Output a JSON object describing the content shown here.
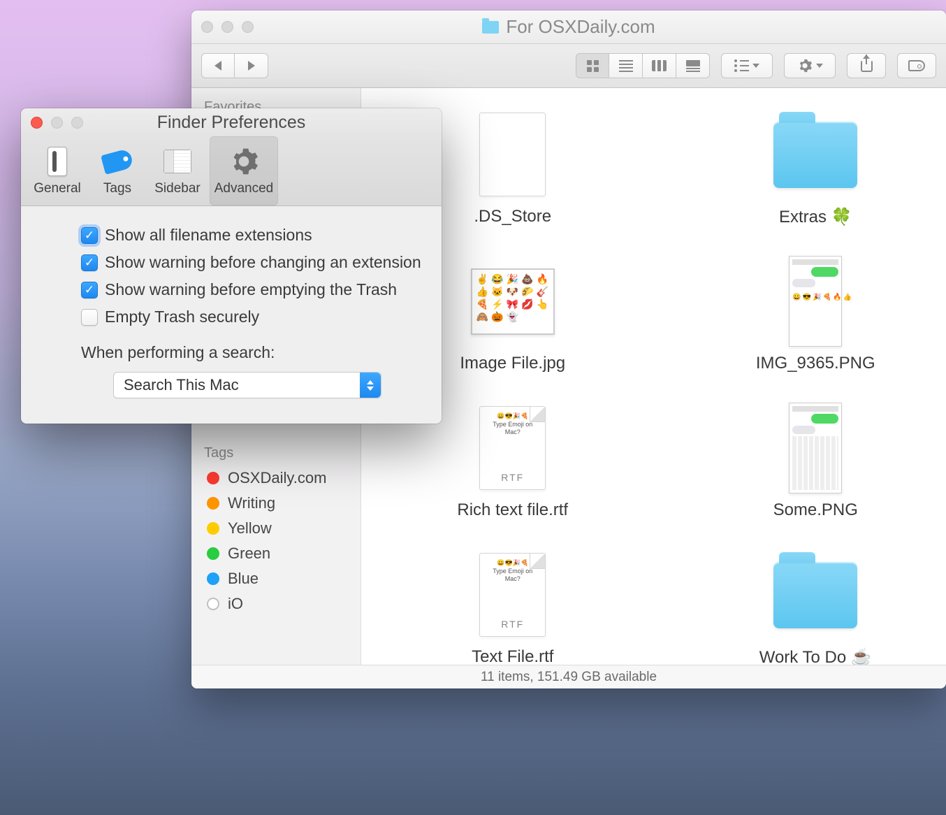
{
  "finder": {
    "title": "For OSXDaily.com",
    "sidebar": {
      "favorites_header": "Favorites",
      "tags_header": "Tags",
      "tags": [
        {
          "label": "OSXDaily.com",
          "color": "#fc3b30"
        },
        {
          "label": "Writing",
          "color": "#ff9500"
        },
        {
          "label": "Yellow",
          "color": "#ffcc00"
        },
        {
          "label": "Green",
          "color": "#28cd41"
        },
        {
          "label": "Blue",
          "color": "#1da1f9"
        },
        {
          "label": "iO",
          "color": "#ffffff"
        }
      ]
    },
    "files": [
      {
        "name": ".DS_Store",
        "kind": "blank"
      },
      {
        "name": "Extras 🍀",
        "kind": "folder"
      },
      {
        "name": "Image File.jpg",
        "kind": "image"
      },
      {
        "name": "IMG_9365.PNG",
        "kind": "phone"
      },
      {
        "name": "Rich text file.rtf",
        "kind": "rtf"
      },
      {
        "name": "Some.PNG",
        "kind": "phone-kb"
      },
      {
        "name": "Text File.rtf",
        "kind": "rtf"
      },
      {
        "name": "Work To Do ☕",
        "kind": "folder"
      }
    ],
    "status": "11 items, 151.49 GB available"
  },
  "prefs": {
    "title": "Finder Preferences",
    "tabs": {
      "general": "General",
      "tags": "Tags",
      "sidebar": "Sidebar",
      "advanced": "Advanced"
    },
    "options": {
      "show_ext": "Show all filename extensions",
      "warn_ext": "Show warning before changing an extension",
      "warn_trash": "Show warning before emptying the Trash",
      "secure_trash": "Empty Trash securely"
    },
    "search_label": "When performing a search:",
    "search_value": "Search This Mac"
  }
}
